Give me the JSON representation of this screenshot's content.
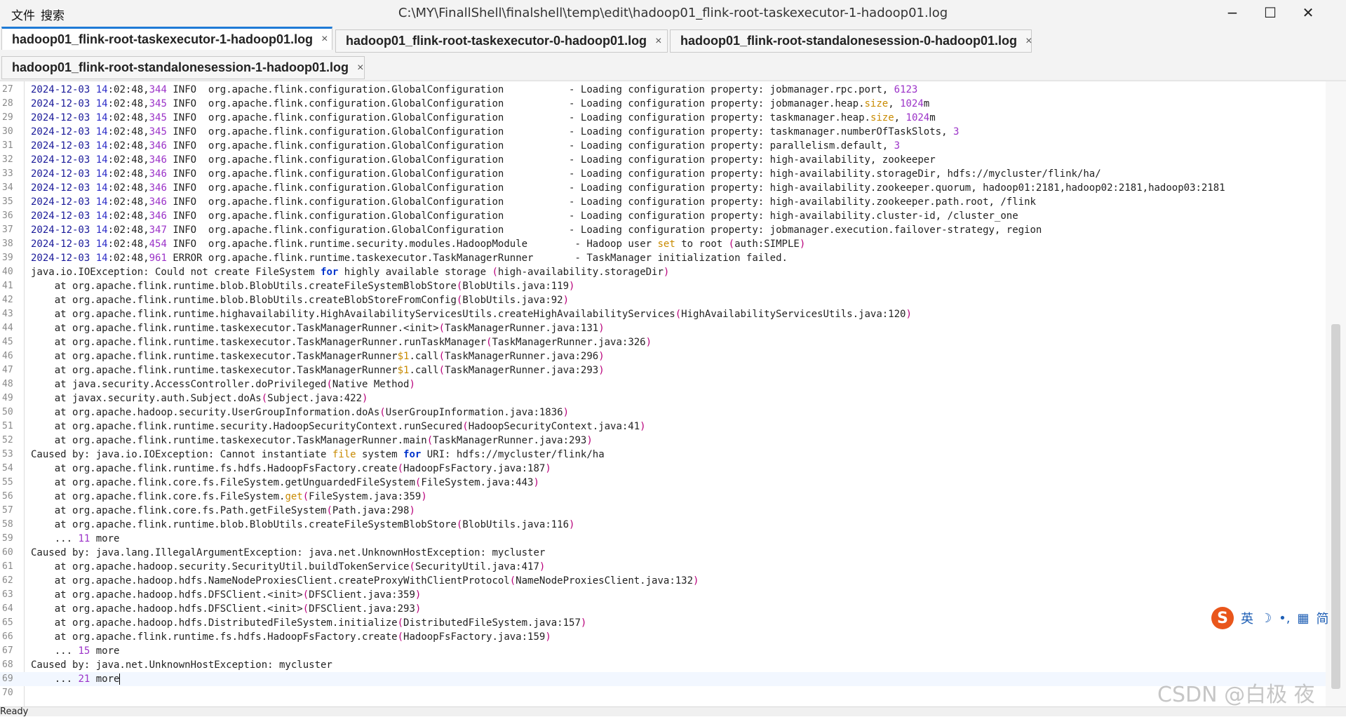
{
  "window": {
    "menu": [
      "文件",
      "搜索"
    ],
    "title": "C:\\MY\\FinallShell\\finalshell\\temp\\edit\\hadoop01_flink-root-taskexecutor-1-hadoop01.log",
    "controls": {
      "minimize": "−",
      "maximize": "☐",
      "close": "✕"
    }
  },
  "tabs": [
    {
      "label": "hadoop01_flink-root-taskexecutor-1-hadoop01.log",
      "active": true,
      "close": "×"
    },
    {
      "label": "hadoop01_flink-root-taskexecutor-0-hadoop01.log",
      "active": false,
      "close": "×"
    },
    {
      "label": "hadoop01_flink-root-standalonesession-0-hadoop01.log",
      "active": false,
      "close": "×"
    },
    {
      "label": "hadoop01_flink-root-standalonesession-1-hadoop01.log",
      "active": false,
      "close": "×"
    }
  ],
  "editor": {
    "first_line_number": 27,
    "current_line": 69,
    "lines": [
      "2024-12-03 14:02:48,344 INFO  org.apache.flink.configuration.GlobalConfiguration           - Loading configuration property: jobmanager.rpc.port, 6123",
      "2024-12-03 14:02:48,345 INFO  org.apache.flink.configuration.GlobalConfiguration           - Loading configuration property: jobmanager.heap.size, 1024m",
      "2024-12-03 14:02:48,345 INFO  org.apache.flink.configuration.GlobalConfiguration           - Loading configuration property: taskmanager.heap.size, 1024m",
      "2024-12-03 14:02:48,345 INFO  org.apache.flink.configuration.GlobalConfiguration           - Loading configuration property: taskmanager.numberOfTaskSlots, 3",
      "2024-12-03 14:02:48,346 INFO  org.apache.flink.configuration.GlobalConfiguration           - Loading configuration property: parallelism.default, 3",
      "2024-12-03 14:02:48,346 INFO  org.apache.flink.configuration.GlobalConfiguration           - Loading configuration property: high-availability, zookeeper",
      "2024-12-03 14:02:48,346 INFO  org.apache.flink.configuration.GlobalConfiguration           - Loading configuration property: high-availability.storageDir, hdfs://mycluster/flink/ha/",
      "2024-12-03 14:02:48,346 INFO  org.apache.flink.configuration.GlobalConfiguration           - Loading configuration property: high-availability.zookeeper.quorum, hadoop01:2181,hadoop02:2181,hadoop03:2181",
      "2024-12-03 14:02:48,346 INFO  org.apache.flink.configuration.GlobalConfiguration           - Loading configuration property: high-availability.zookeeper.path.root, /flink",
      "2024-12-03 14:02:48,346 INFO  org.apache.flink.configuration.GlobalConfiguration           - Loading configuration property: high-availability.cluster-id, /cluster_one",
      "2024-12-03 14:02:48,347 INFO  org.apache.flink.configuration.GlobalConfiguration           - Loading configuration property: jobmanager.execution.failover-strategy, region",
      "2024-12-03 14:02:48,454 INFO  org.apache.flink.runtime.security.modules.HadoopModule        - Hadoop user set to root (auth:SIMPLE)",
      "2024-12-03 14:02:48,961 ERROR org.apache.flink.runtime.taskexecutor.TaskManagerRunner       - TaskManager initialization failed.",
      "java.io.IOException: Could not create FileSystem for highly available storage (high-availability.storageDir)",
      "\tat org.apache.flink.runtime.blob.BlobUtils.createFileSystemBlobStore(BlobUtils.java:119)",
      "\tat org.apache.flink.runtime.blob.BlobUtils.createBlobStoreFromConfig(BlobUtils.java:92)",
      "\tat org.apache.flink.runtime.highavailability.HighAvailabilityServicesUtils.createHighAvailabilityServices(HighAvailabilityServicesUtils.java:120)",
      "\tat org.apache.flink.runtime.taskexecutor.TaskManagerRunner.<init>(TaskManagerRunner.java:131)",
      "\tat org.apache.flink.runtime.taskexecutor.TaskManagerRunner.runTaskManager(TaskManagerRunner.java:326)",
      "\tat org.apache.flink.runtime.taskexecutor.TaskManagerRunner$1.call(TaskManagerRunner.java:296)",
      "\tat org.apache.flink.runtime.taskexecutor.TaskManagerRunner$1.call(TaskManagerRunner.java:293)",
      "\tat java.security.AccessController.doPrivileged(Native Method)",
      "\tat javax.security.auth.Subject.doAs(Subject.java:422)",
      "\tat org.apache.hadoop.security.UserGroupInformation.doAs(UserGroupInformation.java:1836)",
      "\tat org.apache.flink.runtime.security.HadoopSecurityContext.runSecured(HadoopSecurityContext.java:41)",
      "\tat org.apache.flink.runtime.taskexecutor.TaskManagerRunner.main(TaskManagerRunner.java:293)",
      "Caused by: java.io.IOException: Cannot instantiate file system for URI: hdfs://mycluster/flink/ha",
      "\tat org.apache.flink.runtime.fs.hdfs.HadoopFsFactory.create(HadoopFsFactory.java:187)",
      "\tat org.apache.flink.core.fs.FileSystem.getUnguardedFileSystem(FileSystem.java:443)",
      "\tat org.apache.flink.core.fs.FileSystem.get(FileSystem.java:359)",
      "\tat org.apache.flink.core.fs.Path.getFileSystem(Path.java:298)",
      "\tat org.apache.flink.runtime.blob.BlobUtils.createFileSystemBlobStore(BlobUtils.java:116)",
      "\t... 11 more",
      "Caused by: java.lang.IllegalArgumentException: java.net.UnknownHostException: mycluster",
      "\tat org.apache.hadoop.security.SecurityUtil.buildTokenService(SecurityUtil.java:417)",
      "\tat org.apache.hadoop.hdfs.NameNodeProxiesClient.createProxyWithClientProtocol(NameNodeProxiesClient.java:132)",
      "\tat org.apache.hadoop.hdfs.DFSClient.<init>(DFSClient.java:359)",
      "\tat org.apache.hadoop.hdfs.DFSClient.<init>(DFSClient.java:293)",
      "\tat org.apache.hadoop.hdfs.DistributedFileSystem.initialize(DistributedFileSystem.java:157)",
      "\tat org.apache.flink.runtime.fs.hdfs.HadoopFsFactory.create(HadoopFsFactory.java:159)",
      "\t... 15 more",
      "Caused by: java.net.UnknownHostException: mycluster",
      "\t... 21 more",
      ""
    ]
  },
  "status": {
    "text": "Ready"
  },
  "ime": {
    "logo": "S",
    "lang": "英",
    "moon": "☽",
    "punct": "•,",
    "keyboard": "▦",
    "mode": "简"
  },
  "watermark": "CSDN @白极 夜",
  "colors": {
    "accent": "#1e7ad6",
    "keyword": "#0033cc",
    "number": "#9b32c8",
    "paren": "#b8007a"
  }
}
